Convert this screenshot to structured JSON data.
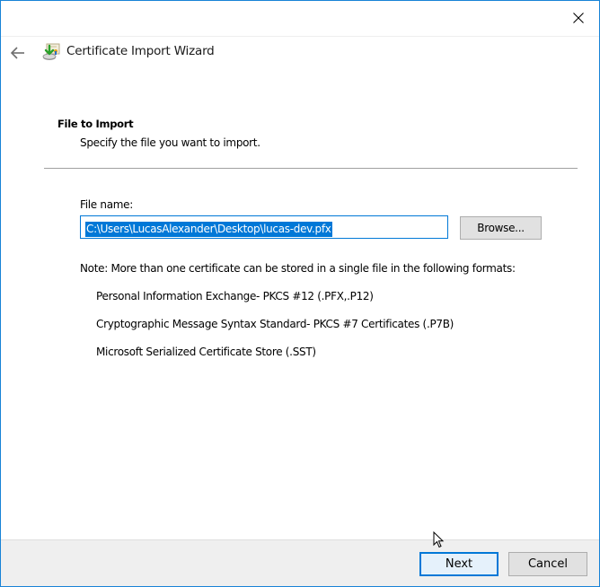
{
  "window": {
    "close_icon": "close-icon",
    "back_icon": "back-arrow-icon",
    "app_icon": "certificate-import-icon",
    "title": "Certificate Import Wizard"
  },
  "page": {
    "section_title": "File to Import",
    "section_description": "Specify the file you want to import."
  },
  "form": {
    "filename_label": "File name:",
    "filename_value": "C:\\Users\\LucasAlexander\\Desktop\\lucas-dev.pfx",
    "browse_label": "Browse..."
  },
  "note": {
    "text": "Note:  More than one certificate can be stored in a single file in the following formats:",
    "formats": [
      "Personal Information Exchange- PKCS #12 (.PFX,.P12)",
      "Cryptographic Message Syntax Standard- PKCS #7 Certificates (.P7B)",
      "Microsoft Serialized Certificate Store (.SST)"
    ]
  },
  "footer": {
    "next_label": "Next",
    "cancel_label": "Cancel"
  },
  "colors": {
    "accent": "#0078d7",
    "window_border": "#1883d7",
    "footer_bg": "#efefef"
  }
}
